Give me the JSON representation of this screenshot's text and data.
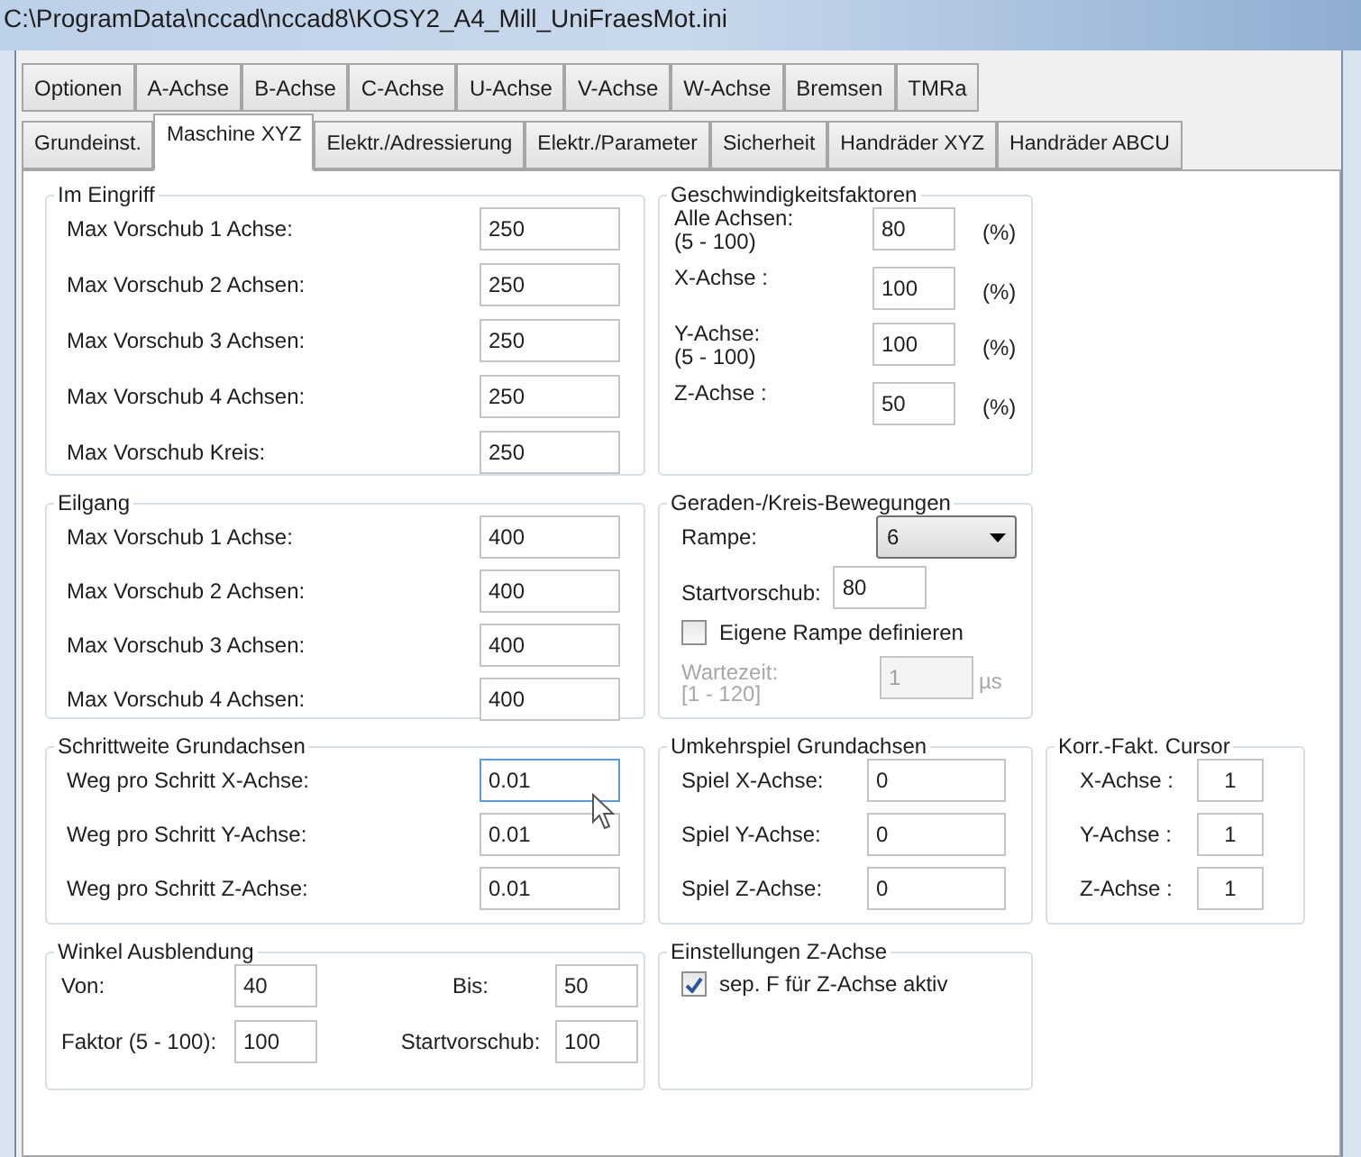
{
  "window": {
    "title": "C:\\ProgramData\\nccad\\nccad8\\KOSY2_A4_Mill_UniFraesMot.ini"
  },
  "tab_rows": [
    [
      {
        "label": "Optionen",
        "selected": false
      },
      {
        "label": "A-Achse",
        "selected": false
      },
      {
        "label": "B-Achse",
        "selected": false
      },
      {
        "label": "C-Achse",
        "selected": false
      },
      {
        "label": "U-Achse",
        "selected": false
      },
      {
        "label": "V-Achse",
        "selected": false
      },
      {
        "label": "W-Achse",
        "selected": false
      },
      {
        "label": "Bremsen",
        "selected": false
      },
      {
        "label": "TMRa",
        "selected": false
      }
    ],
    [
      {
        "label": "Grundeinst.",
        "selected": false
      },
      {
        "label": "Maschine XYZ",
        "selected": true
      },
      {
        "label": "Elektr./Adressierung",
        "selected": false
      },
      {
        "label": "Elektr./Parameter",
        "selected": false
      },
      {
        "label": "Sicherheit",
        "selected": false
      },
      {
        "label": "Handräder XYZ",
        "selected": false
      },
      {
        "label": "Handräder ABCU",
        "selected": false
      }
    ]
  ],
  "im_eingriff": {
    "title": "Im Eingriff",
    "fields": [
      {
        "label": "Max Vorschub 1 Achse:",
        "value": "250"
      },
      {
        "label": "Max Vorschub 2 Achsen:",
        "value": "250"
      },
      {
        "label": "Max Vorschub 3 Achsen:",
        "value": "250"
      },
      {
        "label": "Max Vorschub 4 Achsen:",
        "value": "250"
      },
      {
        "label": "Max Vorschub Kreis:",
        "value": "250"
      }
    ]
  },
  "geschwindigkeitsfaktoren": {
    "title": "Geschwindigkeitsfaktoren",
    "fields": [
      {
        "label": "Alle Achsen:",
        "range": "(5  - 100)",
        "value": "80",
        "unit": "(%)"
      },
      {
        "label": "X-Achse :",
        "value": "100",
        "unit": "(%)"
      },
      {
        "label": "Y-Achse:",
        "range": "(5  - 100)",
        "value": "100",
        "unit": "(%)"
      },
      {
        "label": "Z-Achse :",
        "value": "50",
        "unit": "(%)"
      }
    ]
  },
  "eilgang": {
    "title": "Eilgang",
    "fields": [
      {
        "label": "Max Vorschub 1 Achse:",
        "value": "400"
      },
      {
        "label": "Max Vorschub 2 Achsen:",
        "value": "400"
      },
      {
        "label": "Max Vorschub 3 Achsen:",
        "value": "400"
      },
      {
        "label": "Max Vorschub 4 Achsen:",
        "value": "400"
      }
    ]
  },
  "geraden_kreis": {
    "title": "Geraden-/Kreis-Bewegungen",
    "rampe": {
      "label": "Rampe:",
      "value": "6"
    },
    "startvorschub": {
      "label": "Startvorschub:",
      "value": "80"
    },
    "eigene_rampe": {
      "label": "Eigene Rampe definieren",
      "checked": false
    },
    "wartezeit": {
      "label": "Wartezeit:",
      "range": "[1 - 120]",
      "value": "1",
      "unit": "µs",
      "disabled": true
    }
  },
  "schrittweite": {
    "title": "Schrittweite Grundachsen",
    "fields": [
      {
        "label": "Weg pro Schritt X-Achse:",
        "value": "0.01",
        "focused": true
      },
      {
        "label": "Weg pro Schritt Y-Achse:",
        "value": "0.01",
        "focused": false
      },
      {
        "label": "Weg pro Schritt Z-Achse:",
        "value": "0.01",
        "focused": false
      }
    ]
  },
  "umkehrspiel": {
    "title": "Umkehrspiel Grundachsen",
    "fields": [
      {
        "label": "Spiel X-Achse:",
        "value": "0"
      },
      {
        "label": "Spiel Y-Achse:",
        "value": "0"
      },
      {
        "label": "Spiel Z-Achse:",
        "value": "0"
      }
    ]
  },
  "korr_fakt_cursor": {
    "title": "Korr.-Fakt. Cursor",
    "fields": [
      {
        "label": "X-Achse :",
        "value": "1"
      },
      {
        "label": "Y-Achse :",
        "value": "1"
      },
      {
        "label": "Z-Achse :",
        "value": "1"
      }
    ]
  },
  "winkel_ausblendung": {
    "title": "Winkel Ausblendung",
    "fields": [
      {
        "label": "Von:",
        "value": "40"
      },
      {
        "label": "Bis:",
        "value": "50"
      },
      {
        "label": "Faktor (5 - 100):",
        "value": "100"
      },
      {
        "label": "Startvorschub:",
        "value": "100"
      }
    ]
  },
  "einstellungen_z": {
    "title": "Einstellungen Z-Achse",
    "option": {
      "label": "sep. F für Z-Achse aktiv",
      "checked": true
    }
  }
}
